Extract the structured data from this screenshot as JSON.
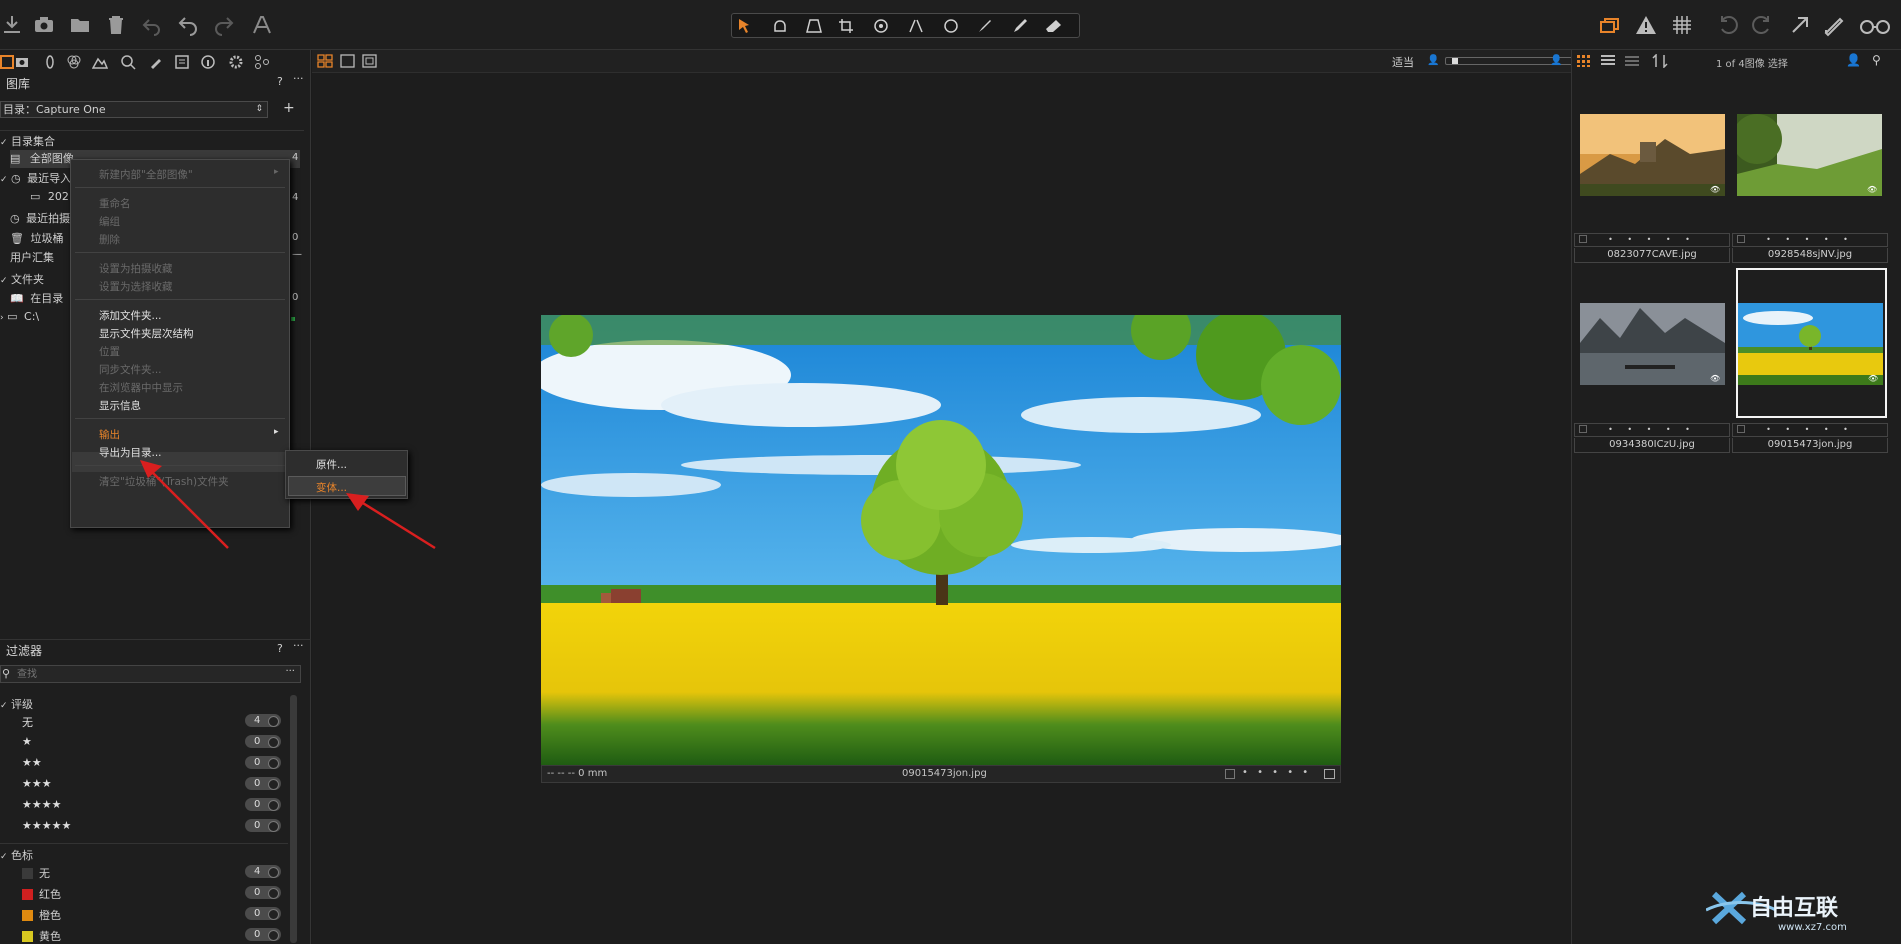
{
  "toolbar": {
    "left_icons": [
      "import-icon",
      "camera-icon",
      "folder-icon",
      "trash-icon",
      "undo-all-icon",
      "undo-icon",
      "redo-icon",
      "text-icon"
    ],
    "cursor_tools": [
      "select-icon",
      "pan-icon",
      "keystone-icon",
      "crop-icon",
      "rotate-icon",
      "straighten-icon",
      "circle-icon",
      "brush-icon",
      "eyedropper-icon",
      "eraser-icon"
    ],
    "right_icons": [
      "layers-icon",
      "warning-icon",
      "grid-icon",
      "rotate-left-icon",
      "rotate-right-icon",
      "expand-icon",
      "edit-icon",
      "glasses-icon"
    ]
  },
  "library": {
    "title": "图库",
    "help": "?",
    "catalog_label": "目录：Capture One",
    "collections_header": "目录集合",
    "all_images": "全部图像",
    "all_images_count": "4",
    "recent_imports": "最近导入",
    "recent_sub": "2021",
    "recent_sub_count": "4",
    "recent_captures": "最近拍摄",
    "trash": "垃圾桶",
    "trash_count": "0",
    "user_collections": "用户汇集",
    "folders_header": "文件夹",
    "in_catalog": "在目录",
    "in_catalog_count": "0",
    "drive": "C:\\"
  },
  "context_menu": {
    "items": [
      {
        "label": "新建内部\"全部图像\"",
        "disabled": true,
        "arrow": true
      },
      {
        "sep": true
      },
      {
        "label": "重命名",
        "disabled": true
      },
      {
        "label": "编组",
        "disabled": true
      },
      {
        "label": "删除",
        "disabled": true
      },
      {
        "sep": true
      },
      {
        "label": "设置为拍摄收藏",
        "disabled": true
      },
      {
        "label": "设置为选择收藏",
        "disabled": true
      },
      {
        "sep": true
      },
      {
        "label": "添加文件夹...",
        "disabled": false
      },
      {
        "label": "显示文件夹层次结构",
        "disabled": false
      },
      {
        "label": "位置",
        "disabled": true
      },
      {
        "label": "同步文件夹...",
        "disabled": true
      },
      {
        "label": "在浏览器中中显示",
        "disabled": true
      },
      {
        "label": "显示信息",
        "disabled": false
      },
      {
        "sep": true
      },
      {
        "label": "输出",
        "disabled": false,
        "arrow": true,
        "highlight": true
      },
      {
        "label": "导出为目录...",
        "disabled": false
      },
      {
        "sep": true
      },
      {
        "label": "清空\"垃圾桶\"(Trash)文件夹",
        "disabled": true
      }
    ],
    "submenu": [
      "原件...",
      "变体..."
    ]
  },
  "filters": {
    "title": "过滤器",
    "help": "?",
    "search_placeholder": "查找",
    "rating_header": "评级",
    "ratings": [
      {
        "label": "无",
        "count": "4"
      },
      {
        "label": "★",
        "count": "0"
      },
      {
        "label": "★★",
        "count": "0"
      },
      {
        "label": "★★★",
        "count": "0"
      },
      {
        "label": "★★★★",
        "count": "0"
      },
      {
        "label": "★★★★★",
        "count": "0"
      }
    ],
    "color_header": "色标",
    "colors": [
      {
        "label": "无",
        "count": "4",
        "color": "#3a3a3a"
      },
      {
        "label": "红色",
        "count": "0",
        "color": "#d02020"
      },
      {
        "label": "橙色",
        "count": "0",
        "color": "#e08a10"
      },
      {
        "label": "黄色",
        "count": "0",
        "color": "#d8c820"
      }
    ]
  },
  "viewer": {
    "fit_label": "适当",
    "bar_left": "-- -- -- 0 mm",
    "filename": "09015473jon.jpg",
    "rating_dots": "• • • • •"
  },
  "browser": {
    "count_label": "1 of 4图像 选择",
    "thumbnails": [
      {
        "name": "0823077CAVE.jpg",
        "selected": false
      },
      {
        "name": "0928548sjNV.jpg",
        "selected": false
      },
      {
        "name": "0934380ICzU.jpg",
        "selected": false
      },
      {
        "name": "09015473jon.jpg",
        "selected": true
      }
    ],
    "dots": "• • • • •"
  },
  "watermark": {
    "text": "自由互联",
    "url": "www.xz7.com"
  }
}
